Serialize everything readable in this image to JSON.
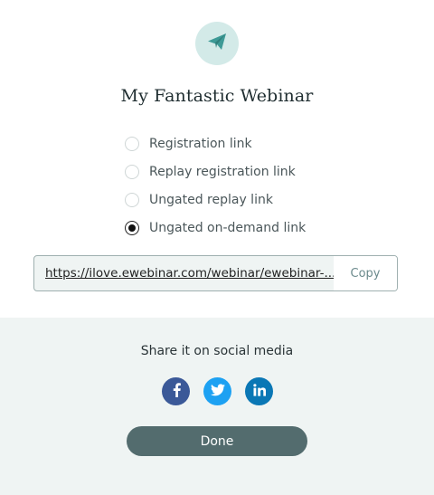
{
  "header": {
    "icon": "paper-plane-icon",
    "title": "My Fantastic Webinar"
  },
  "link_options": {
    "selected_index": 3,
    "items": [
      {
        "label": "Registration link",
        "checked": false
      },
      {
        "label": "Replay registration link",
        "checked": false
      },
      {
        "label": "Ungated replay link",
        "checked": false
      },
      {
        "label": "Ungated on-demand link",
        "checked": true
      }
    ]
  },
  "link_field": {
    "value": "https://ilove.ewebinar.com/webinar/ewebinar-...",
    "copy_label": "Copy"
  },
  "share": {
    "heading": "Share it on social media",
    "networks": [
      {
        "name": "facebook",
        "icon": "facebook-icon",
        "color": "#3b5998"
      },
      {
        "name": "twitter",
        "icon": "twitter-icon",
        "color": "#1da1f2"
      },
      {
        "name": "linkedin",
        "icon": "linkedin-icon",
        "color": "#0a77b5"
      }
    ]
  },
  "footer": {
    "done_label": "Done"
  },
  "colors": {
    "accent": "#3d9a96",
    "badge_bg": "#d3eae8",
    "done_button": "#536c6e",
    "panel_bg": "#eff4f3"
  }
}
